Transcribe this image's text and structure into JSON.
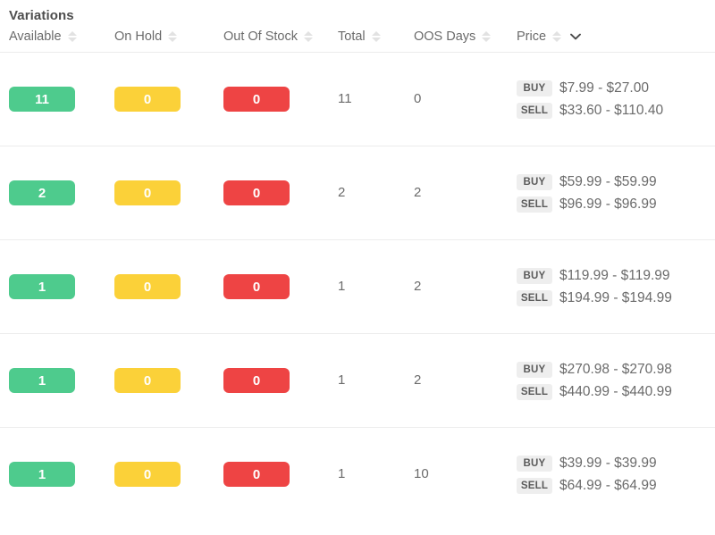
{
  "panel": {
    "title": "Variations"
  },
  "colors": {
    "available_badge": "#4ecb8d",
    "onhold_badge": "#fbd139",
    "outofstock_badge": "#ee4444",
    "price_tag_bg": "#eeeeee",
    "row_divider": "#ececec",
    "text": "#6b6b6b"
  },
  "table": {
    "columns": [
      {
        "key": "available",
        "label": "Available",
        "sortable": true,
        "menu": false
      },
      {
        "key": "onhold",
        "label": "On Hold",
        "sortable": true,
        "menu": false
      },
      {
        "key": "outofstock",
        "label": "Out Of Stock",
        "sortable": true,
        "menu": false
      },
      {
        "key": "total",
        "label": "Total",
        "sortable": true,
        "menu": false
      },
      {
        "key": "oosdays",
        "label": "OOS Days",
        "sortable": true,
        "menu": false
      },
      {
        "key": "price",
        "label": "Price",
        "sortable": true,
        "menu": true
      }
    ],
    "price_labels": {
      "buy": "BUY",
      "sell": "SELL"
    },
    "rows": [
      {
        "available": "11",
        "onhold": "0",
        "outofstock": "0",
        "total": "11",
        "oosdays": "0",
        "buy": "$7.99 - $27.00",
        "sell": "$33.60 - $110.40"
      },
      {
        "available": "2",
        "onhold": "0",
        "outofstock": "0",
        "total": "2",
        "oosdays": "2",
        "buy": "$59.99 - $59.99",
        "sell": "$96.99 - $96.99"
      },
      {
        "available": "1",
        "onhold": "0",
        "outofstock": "0",
        "total": "1",
        "oosdays": "2",
        "buy": "$119.99 - $119.99",
        "sell": "$194.99 - $194.99"
      },
      {
        "available": "1",
        "onhold": "0",
        "outofstock": "0",
        "total": "1",
        "oosdays": "2",
        "buy": "$270.98 - $270.98",
        "sell": "$440.99 - $440.99"
      },
      {
        "available": "1",
        "onhold": "0",
        "outofstock": "0",
        "total": "1",
        "oosdays": "10",
        "buy": "$39.99 - $39.99",
        "sell": "$64.99 - $64.99"
      }
    ]
  }
}
